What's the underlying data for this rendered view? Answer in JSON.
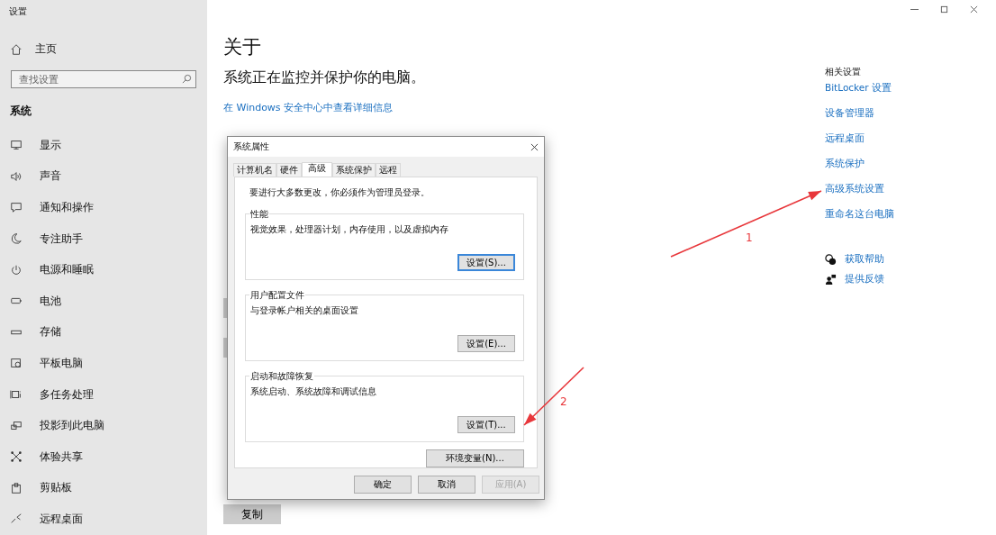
{
  "window": {
    "title": "设置"
  },
  "sidebar": {
    "home": "主页",
    "search": {
      "placeholder": "查找设置"
    },
    "section": "系统",
    "items": [
      {
        "label": "显示",
        "kind": "display"
      },
      {
        "label": "声音",
        "kind": "sound"
      },
      {
        "label": "通知和操作",
        "kind": "notify"
      },
      {
        "label": "专注助手",
        "kind": "moon"
      },
      {
        "label": "电源和睡眠",
        "kind": "power"
      },
      {
        "label": "电池",
        "kind": "battery"
      },
      {
        "label": "存储",
        "kind": "storage"
      },
      {
        "label": "平板电脑",
        "kind": "tablet"
      },
      {
        "label": "多任务处理",
        "kind": "multitask"
      },
      {
        "label": "投影到此电脑",
        "kind": "project"
      },
      {
        "label": "体验共享",
        "kind": "share"
      },
      {
        "label": "剪贴板",
        "kind": "clipboard"
      },
      {
        "label": "远程桌面",
        "kind": "remote"
      }
    ]
  },
  "main": {
    "title": "关于",
    "status": "系统正在监控并保护你的电脑。",
    "link": "在 Windows 安全中心中查看详细信息",
    "copy_button": "复制"
  },
  "related": {
    "title": "相关设置",
    "links": [
      "BitLocker 设置",
      "设备管理器",
      "远程桌面",
      "系统保护",
      "高级系统设置",
      "重命名这台电脑"
    ],
    "help": [
      {
        "kind": "help",
        "label": "获取帮助"
      },
      {
        "kind": "feedback",
        "label": "提供反馈"
      }
    ]
  },
  "dialog": {
    "title": "系统属性",
    "tabs": [
      {
        "label": "计算机名",
        "selected": false
      },
      {
        "label": "硬件",
        "selected": false
      },
      {
        "label": "高级",
        "selected": true
      },
      {
        "label": "系统保护",
        "selected": false
      },
      {
        "label": "远程",
        "selected": false
      }
    ],
    "notice": "要进行大多数更改，你必须作为管理员登录。",
    "groups": [
      {
        "title": "性能",
        "description": "视觉效果，处理器计划，内存使用，以及虚拟内存",
        "button": "设置(S)...",
        "focused": true
      },
      {
        "title": "用户配置文件",
        "description": "与登录帐户相关的桌面设置",
        "button": "设置(E)...",
        "focused": false
      },
      {
        "title": "启动和故障恢复",
        "description": "系统启动、系统故障和调试信息",
        "button": "设置(T)...",
        "focused": false
      }
    ],
    "env_button": "环境变量(N)...",
    "buttons": [
      {
        "label": "确定",
        "disabled": false
      },
      {
        "label": "取消",
        "disabled": false
      },
      {
        "label": "应用(A)",
        "disabled": true
      }
    ]
  },
  "annotations": [
    {
      "label": "1"
    },
    {
      "label": "2"
    }
  ]
}
